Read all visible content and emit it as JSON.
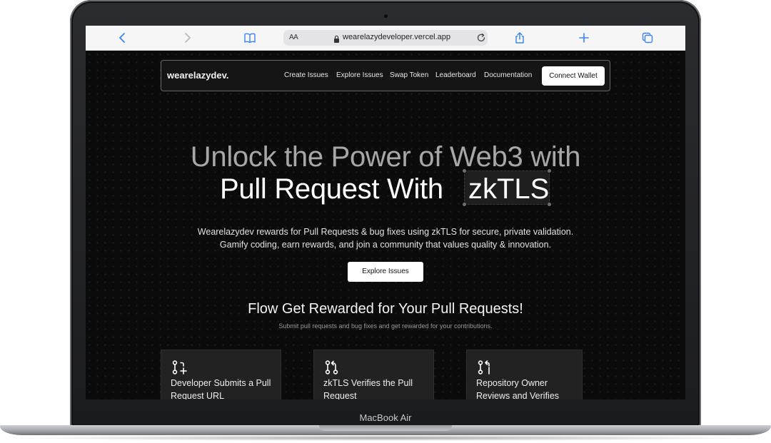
{
  "device": {
    "label": "MacBook Air"
  },
  "browser": {
    "text_size_label": "AA",
    "url": "wearelazydeveloper.vercel.app",
    "icons": [
      "back-icon",
      "forward-icon",
      "bookmarks-icon",
      "lock-icon",
      "reload-icon",
      "share-icon",
      "new-tab-icon",
      "tabs-icon"
    ]
  },
  "nav": {
    "brand": "wearelazydev.",
    "links": [
      "Create Issues",
      "Explore Issues",
      "Swap Token",
      "Leaderboard",
      "Documentation"
    ],
    "cta": "Connect Wallet"
  },
  "hero": {
    "line1": "Unlock the Power of Web3 with",
    "line2_prefix": "Pull Request With",
    "line2_highlight": "zkTLS",
    "description_line1": "Wearelazydev rewards for Pull Requests & bug fixes using zkTLS for secure, private validation.",
    "description_line2": "Gamify coding, earn rewards, and join a community that values quality & innovation.",
    "button": "Explore Issues"
  },
  "flow": {
    "title": "Flow Get Rewarded for Your Pull Requests!",
    "subtitle": "Submit pull requests and bug fixes and get rewarded for your contributions.",
    "steps": [
      {
        "icon": "git-pull-request-icon",
        "label": "Developer Submits a Pull Request URL"
      },
      {
        "icon": "git-compare-icon",
        "label": "zkTLS Verifies the Pull Request"
      },
      {
        "icon": "git-pull-request-arrow-icon",
        "label": "Repository Owner Reviews and Verifies"
      }
    ]
  },
  "colors": {
    "page_bg": "#0b0b0b",
    "card_bg": "#222222",
    "text_primary": "#ffffff",
    "text_muted": "#a7a7a7",
    "button_bg": "#ffffff",
    "toolbar_accent": "#3b82f6"
  }
}
